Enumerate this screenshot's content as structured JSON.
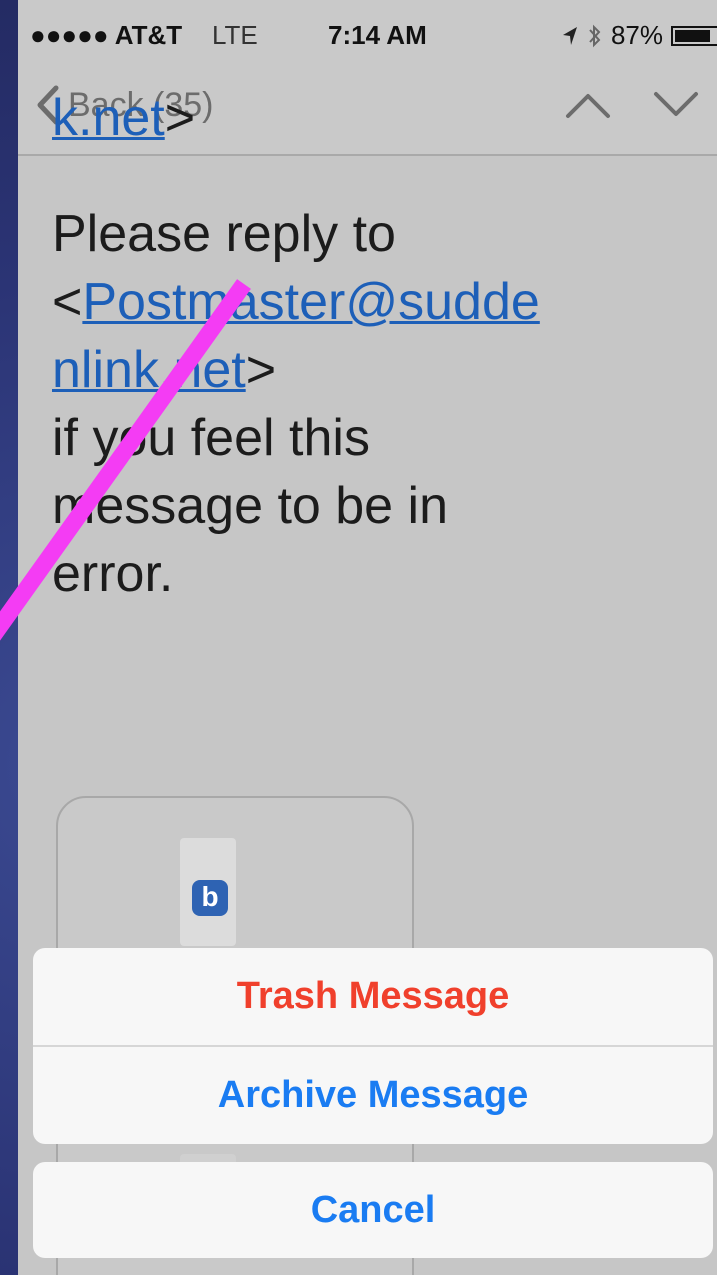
{
  "status_bar": {
    "carrier": "●●●●● AT&T",
    "network": "LTE",
    "time": "7:14 AM",
    "battery": "87%",
    "battery_level": 0.87
  },
  "nav": {
    "back_label": "Back (35)"
  },
  "message": {
    "cut_text": "k.net",
    "cut_suffix": ">",
    "line1": "Please reply to",
    "link_prefix": "<",
    "link_part1": "Postmaster@sudde",
    "link_part2": "nlink.net",
    "link_suffix": ">",
    "line3": "if you feel this",
    "line4": "message to be in",
    "line5": "error."
  },
  "attachment": {
    "icon_letter": "b"
  },
  "action_sheet": {
    "trash_label": "Trash Message",
    "archive_label": "Archive Message",
    "cancel_label": "Cancel"
  },
  "colors": {
    "destructive": "#f0402c",
    "action": "#1a7cf2",
    "link": "#1d5fb8",
    "annotation": "#f43cf4"
  }
}
